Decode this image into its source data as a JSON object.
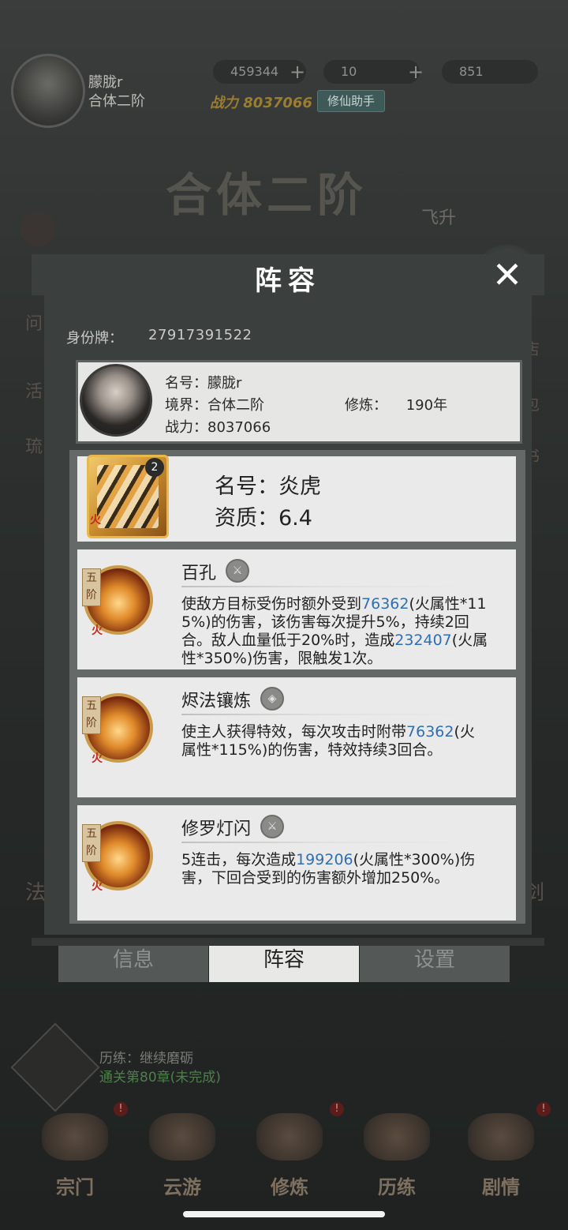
{
  "background": {
    "player": {
      "name": "朦胧r",
      "realm": "合体二阶"
    },
    "resources": [
      {
        "icon": "spirit-stone-icon",
        "value": "459344"
      },
      {
        "icon": "jade-icon",
        "value": "10"
      },
      {
        "icon": "scroll-icon",
        "value": "851"
      }
    ],
    "power_label": "战力",
    "power_value": "8037066",
    "helper_label": "修仙助手",
    "realm_banner": "合体二阶",
    "ascend_label": "飞升",
    "training": {
      "title": "历练：继续磨砺",
      "chapter": "通关第80章(未完成)"
    },
    "side_left": [
      "问",
      "活",
      "琉",
      "法"
    ],
    "side_right": [
      "店",
      "包",
      "书",
      "剑"
    ],
    "nav": [
      {
        "label": "宗门",
        "icon": "sect-icon",
        "badge": "!"
      },
      {
        "label": "云游",
        "icon": "travel-icon",
        "badge": "!"
      },
      {
        "label": "修炼",
        "icon": "cultivate-icon",
        "badge": ""
      },
      {
        "label": "历练",
        "icon": "trial-icon",
        "badge": ""
      },
      {
        "label": "剧情",
        "icon": "story-icon",
        "badge": "!"
      }
    ]
  },
  "dialog": {
    "title": "阵容",
    "close_icon": "close-icon",
    "id_label": "身份牌：",
    "id_value": "27917391522",
    "profile": {
      "name_label": "名号：",
      "name_value": "朦胧r",
      "realm_label": "境界：",
      "realm_value": "合体二阶",
      "cultivate_label": "修炼：",
      "cultivate_value": "190年",
      "power_label": "战力：",
      "power_value": "8037066"
    },
    "pet": {
      "level": "2",
      "element": "火",
      "name_label": "名号：",
      "name_value": "炎虎",
      "quality_label": "资质：",
      "quality_value": "6.4"
    },
    "skills": [
      {
        "tier": "五阶",
        "element": "火",
        "name": "百孔",
        "badge_icon": "sword-badge-icon",
        "desc_before": "使敌方目标受伤时额外受到",
        "num1": "76362",
        "desc_mid": "(火属性*115%)的伤害，该伤害每次提升5%，持续2回合。敌人血量低于20%时，造成",
        "num2": "232407",
        "desc_after": "(火属性*350%)伤害，限触发1次。"
      },
      {
        "tier": "五阶",
        "element": "火",
        "name": "烬法镶炼",
        "badge_icon": "shield-badge-icon",
        "desc_before": "使主人获得特效，每次攻击时附带",
        "num1": "76362",
        "desc_after": "(火属性*115%)的伤害，特效持续3回合。"
      },
      {
        "tier": "五阶",
        "element": "火",
        "name": "修罗灯闪",
        "badge_icon": "sword-badge-icon",
        "desc_before": "5连击，每次造成",
        "num1": "199206",
        "desc_after": "(火属性*300%)伤害，下回合受到的伤害额外增加250%。"
      }
    ],
    "tabs": [
      {
        "label": "信息",
        "active": false
      },
      {
        "label": "阵容",
        "active": true
      },
      {
        "label": "设置",
        "active": false
      }
    ]
  },
  "colors": {
    "accent_number": "#2f6fb0",
    "fire": "#c4291e"
  }
}
